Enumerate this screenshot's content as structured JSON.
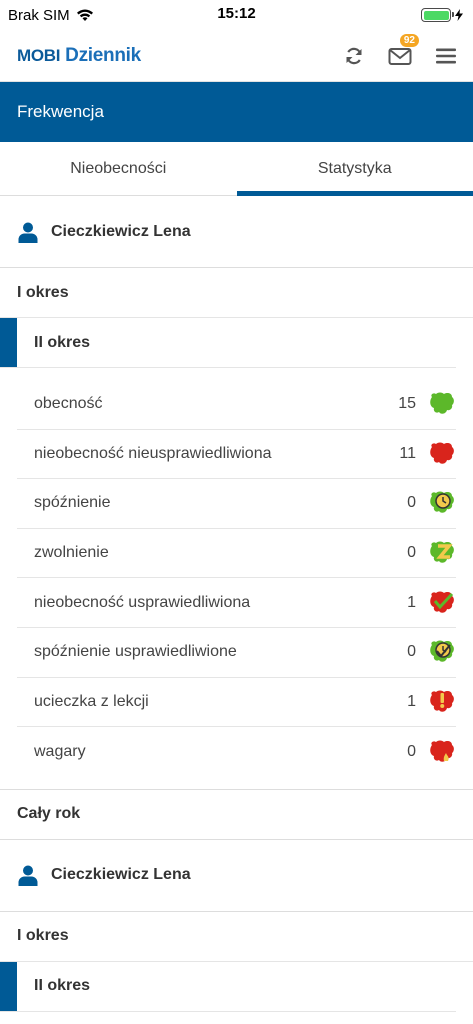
{
  "status_bar": {
    "carrier": "Brak SIM",
    "time": "15:12"
  },
  "header": {
    "logo_part1": "mobi",
    "logo_part2": "Dziennik",
    "messages_badge": "92"
  },
  "title_bar": {
    "title": "Frekwencja"
  },
  "tabs": [
    {
      "label": "Nieobecności",
      "active": false
    },
    {
      "label": "Statystyka",
      "active": true
    }
  ],
  "student": {
    "name": "Cieczkiewicz Lena"
  },
  "periods": {
    "first": "I okres",
    "second": "II okres"
  },
  "stats": [
    {
      "label": "obecność",
      "count": "15",
      "icon": "present-icon",
      "color": "#5cb82a"
    },
    {
      "label": "nieobecność nieusprawiedliwiona",
      "count": "11",
      "icon": "absent-icon",
      "color": "#d9241c"
    },
    {
      "label": "spóźnienie",
      "count": "0",
      "icon": "late-clock-icon",
      "color": "#5cb82a"
    },
    {
      "label": "zwolnienie",
      "count": "0",
      "icon": "released-icon",
      "color": "#5cb82a"
    },
    {
      "label": "nieobecność usprawiedliwiona",
      "count": "1",
      "icon": "excused-absence-icon",
      "color": "#d9241c"
    },
    {
      "label": "spóźnienie usprawiedliwione",
      "count": "0",
      "icon": "excused-late-icon",
      "color": "#5cb82a"
    },
    {
      "label": "ucieczka z lekcji",
      "count": "1",
      "icon": "escape-icon",
      "color": "#d9241c"
    },
    {
      "label": "wagary",
      "count": "0",
      "icon": "truancy-icon",
      "color": "#d9241c"
    }
  ],
  "full_year": {
    "label": "Cały rok"
  },
  "student2": {
    "name": "Cieczkiewicz Lena"
  },
  "periods2": {
    "first": "I okres",
    "second": "II okres"
  }
}
